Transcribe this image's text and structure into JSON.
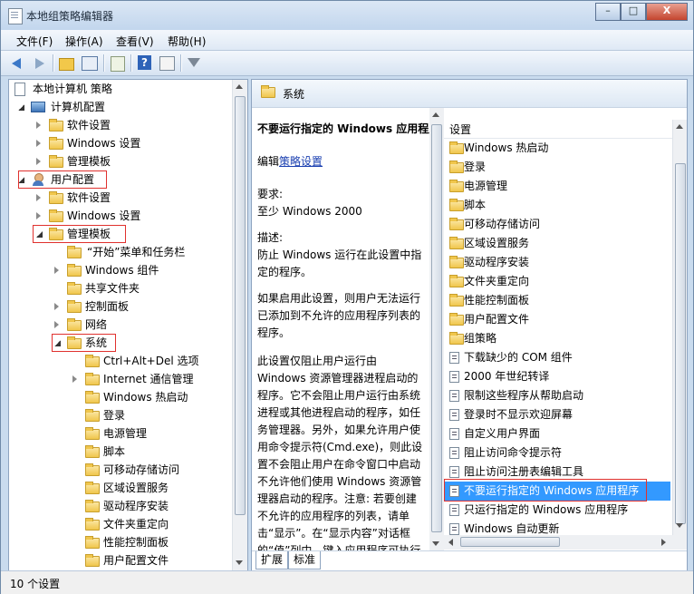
{
  "window": {
    "title": "本地组策略编辑器",
    "controls": {
      "minimize": "–",
      "maximize": "□",
      "close": "X"
    }
  },
  "menu": [
    "文件(F)",
    "操作(A)",
    "查看(V)",
    "帮助(H)"
  ],
  "toolbar": [
    "back-icon",
    "forward-icon",
    "up-folder-icon",
    "show-tree-icon",
    "export-icon",
    "help-icon",
    "properties-icon",
    "filter-icon"
  ],
  "tree": {
    "root": "本地计算机 策略",
    "computer_config": "计算机配置",
    "cc_software": "软件设置",
    "cc_windows": "Windows 设置",
    "cc_admin": "管理模板",
    "user_config": "用户配置",
    "uc_software": "软件设置",
    "uc_windows": "Windows 设置",
    "uc_admin": "管理模板",
    "start_menu": "“开始”菜单和任务栏",
    "win_components": "Windows 组件",
    "shared_folders": "共享文件夹",
    "control_panel": "控制面板",
    "network": "网络",
    "system": "系统",
    "sys_children": [
      "Ctrl+Alt+Del 选项",
      "Internet 通信管理",
      "Windows 热启动",
      "登录",
      "电源管理",
      "脚本",
      "可移动存储访问",
      "区域设置服务",
      "驱动程序安装",
      "文件夹重定向",
      "性能控制面板",
      "用户配置文件"
    ]
  },
  "right": {
    "header": "系统",
    "desc_title": "不要运行指定的 Windows 应用程序",
    "desc_edit": "编辑",
    "desc_link": "策略设置",
    "req_label": "要求:",
    "req_value": "至少 Windows 2000",
    "desc_label": "描述:",
    "desc_body": "防止 Windows 运行在此设置中指定的程序。",
    "desc_p2": "如果启用此设置，则用户无法运行已添加到不允许的应用程序列表的程序。",
    "desc_p3": "此设置仅阻止用户运行由 Windows 资源管理器进程启动的程序。它不会阻止用户运行由系统进程或其他进程启动的程序，如任务管理器。另外，如果允许用户使用命令提示符(Cmd.exe)，则此设置不会阻止用户在命令窗口中启动不允许他们使用 Windows 资源管理器启动的程序。注意: 若要创建不允许的应用程序的列表，请单击“显示”。在“显示内容”对话框的“值”列中，键入应用程序可执行文件名(例如，Winword.exe、",
    "col_header": "设置",
    "items": [
      {
        "label": "Windows 热启动",
        "type": "folder"
      },
      {
        "label": "登录",
        "type": "folder"
      },
      {
        "label": "电源管理",
        "type": "folder"
      },
      {
        "label": "脚本",
        "type": "folder"
      },
      {
        "label": "可移动存储访问",
        "type": "folder"
      },
      {
        "label": "区域设置服务",
        "type": "folder"
      },
      {
        "label": "驱动程序安装",
        "type": "folder"
      },
      {
        "label": "文件夹重定向",
        "type": "folder"
      },
      {
        "label": "性能控制面板",
        "type": "folder"
      },
      {
        "label": "用户配置文件",
        "type": "folder"
      },
      {
        "label": "组策略",
        "type": "folder"
      },
      {
        "label": "下载缺少的 COM 组件",
        "type": "setting"
      },
      {
        "label": "2000 年世纪转译",
        "type": "setting"
      },
      {
        "label": "限制这些程序从帮助启动",
        "type": "setting"
      },
      {
        "label": "登录时不显示欢迎屏幕",
        "type": "setting"
      },
      {
        "label": "自定义用户界面",
        "type": "setting"
      },
      {
        "label": "阻止访问命令提示符",
        "type": "setting"
      },
      {
        "label": "阻止访问注册表编辑工具",
        "type": "setting"
      },
      {
        "label": "不要运行指定的 Windows 应用程序",
        "type": "setting",
        "selected": true
      },
      {
        "label": "只运行指定的 Windows 应用程序",
        "type": "setting"
      },
      {
        "label": "Windows 自动更新",
        "type": "setting"
      }
    ],
    "tabs": [
      "扩展",
      "标准"
    ]
  },
  "status": "10 个设置"
}
